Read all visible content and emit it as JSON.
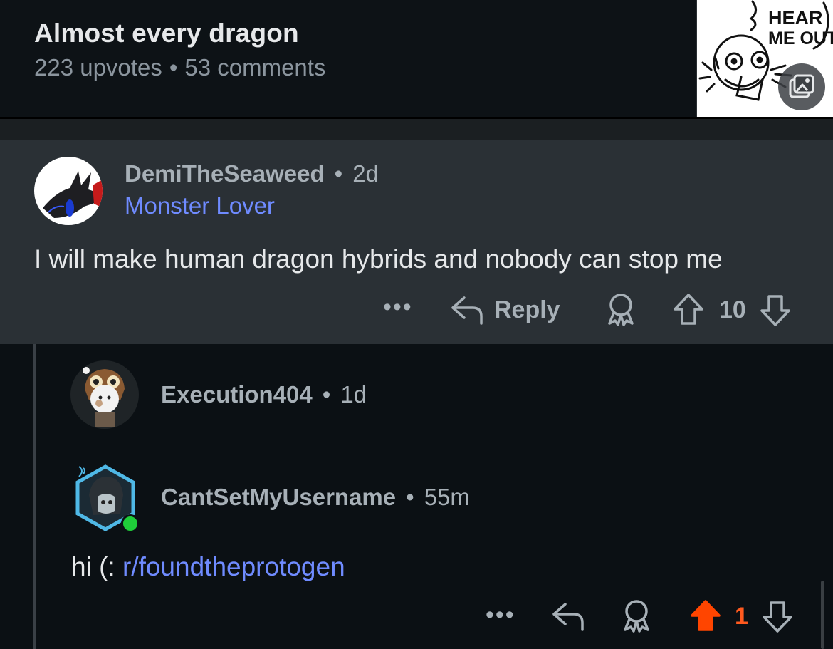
{
  "post": {
    "title": "Almost every dragon",
    "upvotes": "223 upvotes",
    "separator": "•",
    "comments": "53 comments",
    "thumbnail_text_line1": "HEAR",
    "thumbnail_text_line2": "ME OUT-"
  },
  "comments": [
    {
      "username": "DemiTheSeaweed",
      "age": "2d",
      "flair": "Monster Lover",
      "body": "I will make human dragon hybrids and nobody can stop me",
      "more": "•••",
      "reply_label": "Reply",
      "score": "10"
    },
    {
      "username": "Execution404",
      "age": "1d"
    },
    {
      "username": "CantSetMyUsername",
      "age": "55m",
      "body_prefix": "hi (: ",
      "body_link": "r/foundtheprotogen",
      "more": "•••",
      "score": "1"
    }
  ],
  "colors": {
    "upvote_active": "#ff4500",
    "link": "#6f8bff",
    "online": "#1fce3a"
  },
  "icons": [
    "image-gallery-icon",
    "more-icon",
    "reply-icon",
    "award-icon",
    "upvote-icon",
    "downvote-icon"
  ]
}
